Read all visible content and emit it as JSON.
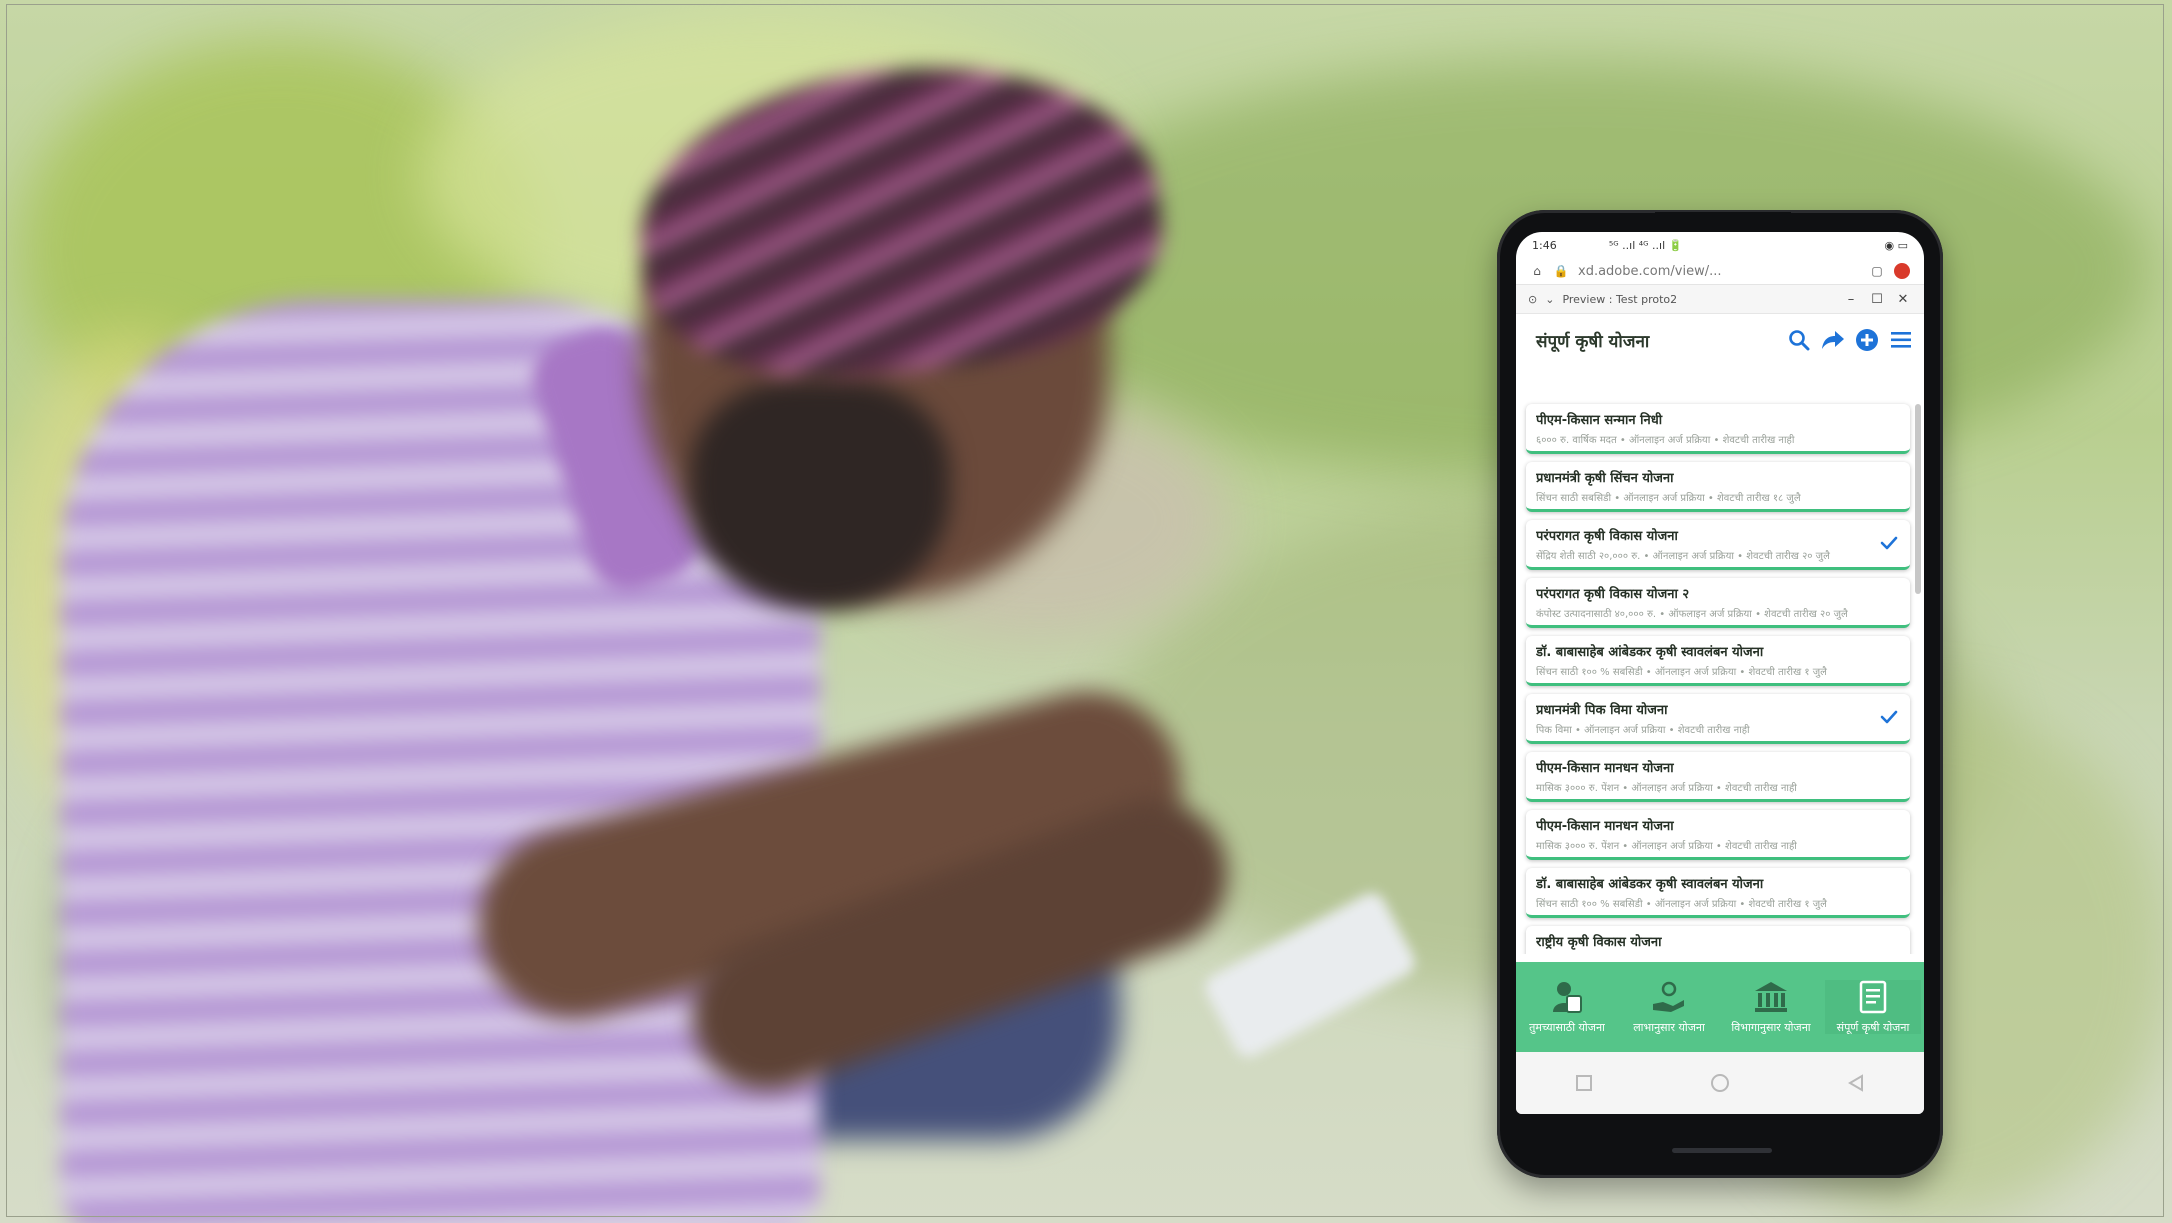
{
  "status_bar": {
    "time": "1:46",
    "signal": "⁵ᴳ ..ıl ⁴ᴳ ..ıl 🔋",
    "battery": "◉ ▭"
  },
  "browser": {
    "url": "xd.adobe.com/view/..."
  },
  "preview_bar": {
    "title": "Preview : Test proto2"
  },
  "app": {
    "title": "संपूर्ण कृषी योजना",
    "icons": [
      "search-icon",
      "share-icon",
      "add-circle-icon",
      "menu-icon"
    ],
    "accent_color": "#3fbf7e",
    "icon_color": "#1e73d8"
  },
  "schemes": [
    {
      "name": "पीएम-किसान सन्मान निधी",
      "desc": "६००० रु. वार्षिक मदत • ऑनलाइन अर्ज प्रक्रिया • शेवटची तारीख नाही",
      "checked": false
    },
    {
      "name": "प्रधानमंत्री कृषी सिंचन योजना",
      "desc": "सिंचन साठी सबसिडी • ऑनलाइन अर्ज प्रक्रिया • शेवटची तारीख १८ जुलै",
      "checked": false
    },
    {
      "name": "परंपरागत कृषी विकास योजना",
      "desc": "सेंद्रिय शेती साठी २०,००० रु. • ऑनलाइन अर्ज प्रक्रिया • शेवटची तारीख २० जुलै",
      "checked": true
    },
    {
      "name": "परंपरागत कृषी विकास योजना २",
      "desc": "कंपोस्ट उत्पादनासाठी ४०,००० रु. • ऑफलाइन अर्ज प्रक्रिया • शेवटची तारीख २० जुलै",
      "checked": false
    },
    {
      "name": "डॉ. बाबासाहेब आंबेडकर कृषी स्वावलंबन योजना",
      "desc": "सिंचन साठी १०० % सबसिडी • ऑनलाइन अर्ज प्रक्रिया • शेवटची तारीख १ जुलै",
      "checked": false
    },
    {
      "name": "प्रधानमंत्री पिक विमा योजना",
      "desc": "पिक विमा • ऑनलाइन अर्ज प्रक्रिया • शेवटची तारीख नाही",
      "checked": true
    },
    {
      "name": "पीएम-किसान मानधन योजना",
      "desc": "मासिक ३००० रु. पेंशन • ऑनलाइन अर्ज प्रक्रिया • शेवटची तारीख नाही",
      "checked": false
    },
    {
      "name": "पीएम-किसान मानधन योजना",
      "desc": "मासिक ३००० रु. पेंशन • ऑनलाइन अर्ज प्रक्रिया • शेवटची तारीख नाही",
      "checked": false
    },
    {
      "name": "डॉ. बाबासाहेब आंबेडकर कृषी स्वावलंबन योजना",
      "desc": "सिंचन साठी १०० % सबसिडी • ऑनलाइन अर्ज प्रक्रिया • शेवटची तारीख १ जुलै",
      "checked": false
    },
    {
      "name": "राष्ट्रीय कृषी विकास योजना",
      "desc": "",
      "checked": false
    }
  ],
  "bottom_nav": [
    {
      "label": "तुमच्यासाठी योजना",
      "icon": "person-document-icon",
      "active": false
    },
    {
      "label": "लाभानुसार योजना",
      "icon": "hand-coins-icon",
      "active": false
    },
    {
      "label": "विभागानुसार योजना",
      "icon": "government-building-icon",
      "active": false
    },
    {
      "label": "संपूर्ण कृषी योजना",
      "icon": "document-list-icon",
      "active": true
    }
  ]
}
